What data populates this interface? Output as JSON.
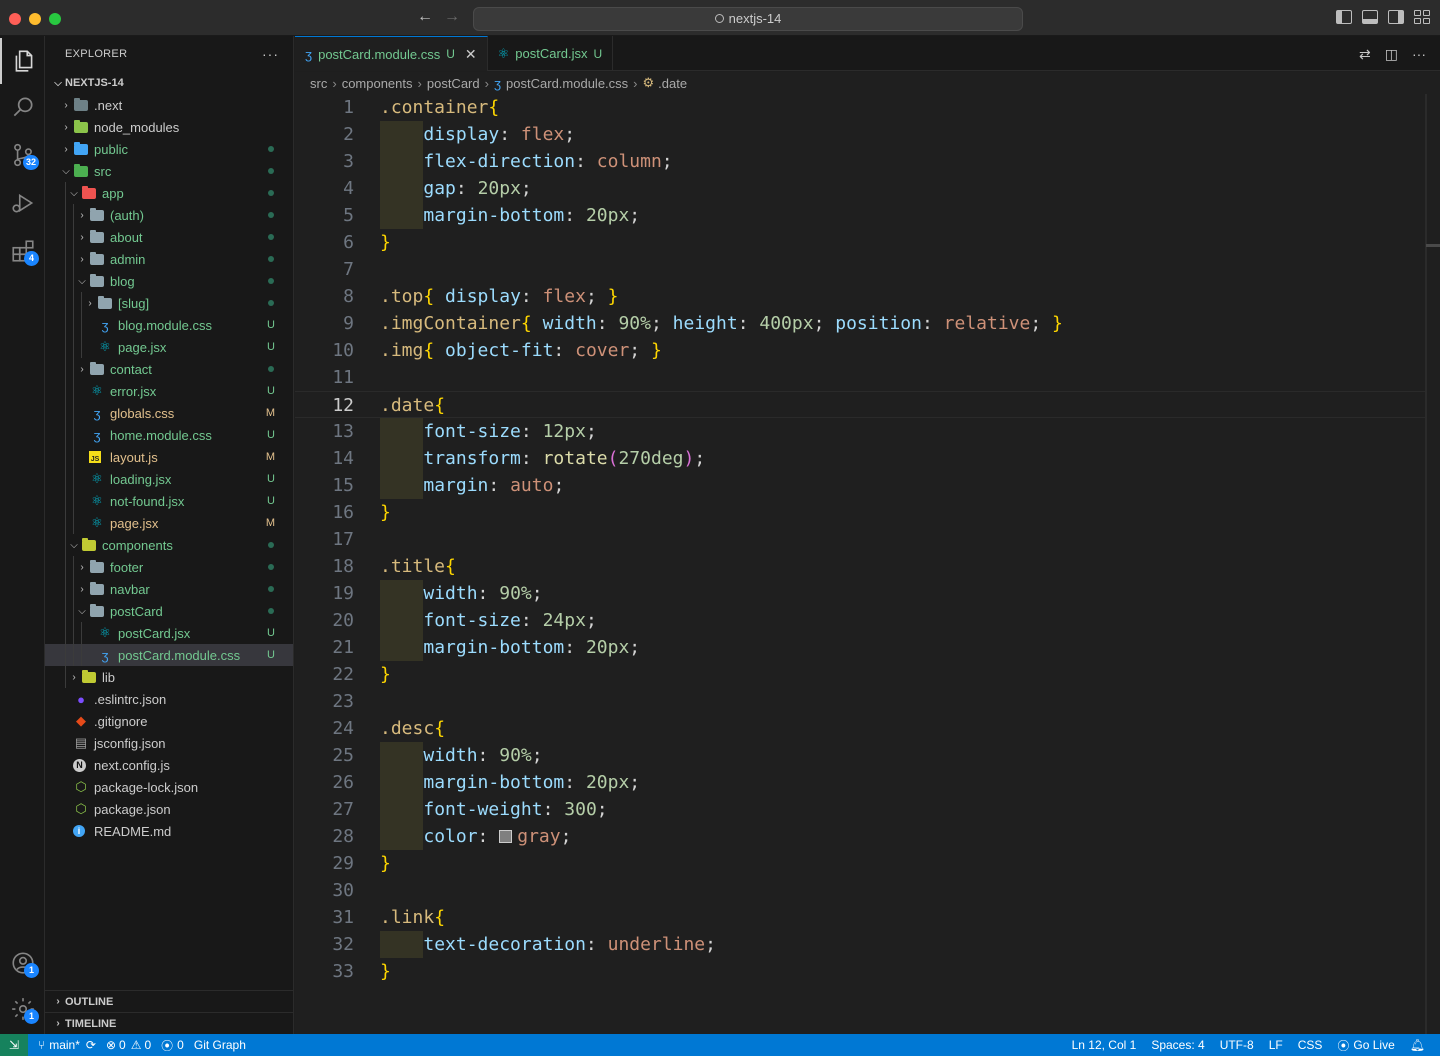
{
  "titlebar": {
    "search_text": "nextjs-14"
  },
  "activity": {
    "source_control_badge": "32",
    "extensions_badge": "4",
    "accounts_badge": "1",
    "manage_badge": "1"
  },
  "sidebar": {
    "title": "EXPLORER",
    "more": "···",
    "root": "NEXTJS-14",
    "tree": [
      {
        "name": ".next",
        "depth": 0,
        "type": "folder",
        "open": false,
        "color": "#6d8086",
        "status": "",
        "dot": false
      },
      {
        "name": "node_modules",
        "depth": 0,
        "type": "folder",
        "open": false,
        "color": "#8bc34a",
        "status": "",
        "dot": false
      },
      {
        "name": "public",
        "depth": 0,
        "type": "folder",
        "open": false,
        "color": "#42a5f5",
        "status": "",
        "dot": true
      },
      {
        "name": "src",
        "depth": 0,
        "type": "folder",
        "open": true,
        "color": "#4caf50",
        "status": "",
        "dot": true
      },
      {
        "name": "app",
        "depth": 1,
        "type": "folder",
        "open": true,
        "color": "#ef5350",
        "status": "",
        "dot": true
      },
      {
        "name": "(auth)",
        "depth": 2,
        "type": "folder",
        "open": false,
        "color": "#90a4ae",
        "status": "",
        "dot": true
      },
      {
        "name": "about",
        "depth": 2,
        "type": "folder",
        "open": false,
        "color": "#90a4ae",
        "status": "",
        "dot": true
      },
      {
        "name": "admin",
        "depth": 2,
        "type": "folder",
        "open": false,
        "color": "#90a4ae",
        "status": "",
        "dot": true
      },
      {
        "name": "blog",
        "depth": 2,
        "type": "folder",
        "open": true,
        "color": "#90a4ae",
        "status": "",
        "dot": true
      },
      {
        "name": "[slug]",
        "depth": 3,
        "type": "folder",
        "open": false,
        "color": "#90a4ae",
        "status": "",
        "dot": true
      },
      {
        "name": "blog.module.css",
        "depth": 3,
        "type": "css",
        "status": "U",
        "dot": false
      },
      {
        "name": "page.jsx",
        "depth": 3,
        "type": "react",
        "status": "U",
        "dot": false
      },
      {
        "name": "contact",
        "depth": 2,
        "type": "folder",
        "open": false,
        "color": "#90a4ae",
        "status": "",
        "dot": true
      },
      {
        "name": "error.jsx",
        "depth": 2,
        "type": "react",
        "status": "U",
        "dot": false
      },
      {
        "name": "globals.css",
        "depth": 2,
        "type": "css",
        "status": "M",
        "dot": false
      },
      {
        "name": "home.module.css",
        "depth": 2,
        "type": "css",
        "status": "U",
        "dot": false
      },
      {
        "name": "layout.js",
        "depth": 2,
        "type": "js",
        "status": "M",
        "dot": false
      },
      {
        "name": "loading.jsx",
        "depth": 2,
        "type": "react",
        "status": "U",
        "dot": false
      },
      {
        "name": "not-found.jsx",
        "depth": 2,
        "type": "react",
        "status": "U",
        "dot": false
      },
      {
        "name": "page.jsx",
        "depth": 2,
        "type": "react",
        "status": "M",
        "dot": false
      },
      {
        "name": "components",
        "depth": 1,
        "type": "folder",
        "open": true,
        "color": "#c0ca33",
        "status": "",
        "dot": true
      },
      {
        "name": "footer",
        "depth": 2,
        "type": "folder",
        "open": false,
        "color": "#90a4ae",
        "status": "",
        "dot": true
      },
      {
        "name": "navbar",
        "depth": 2,
        "type": "folder",
        "open": false,
        "color": "#90a4ae",
        "status": "",
        "dot": true
      },
      {
        "name": "postCard",
        "depth": 2,
        "type": "folder",
        "open": true,
        "color": "#90a4ae",
        "status": "",
        "dot": true
      },
      {
        "name": "postCard.jsx",
        "depth": 3,
        "type": "react",
        "status": "U",
        "dot": false
      },
      {
        "name": "postCard.module.css",
        "depth": 3,
        "type": "css",
        "status": "U",
        "dot": false,
        "selected": true
      },
      {
        "name": "lib",
        "depth": 1,
        "type": "folder",
        "open": false,
        "color": "#c0ca33",
        "status": "",
        "dot": false
      },
      {
        "name": ".eslintrc.json",
        "depth": 0,
        "type": "eslint",
        "status": "",
        "dot": false
      },
      {
        "name": ".gitignore",
        "depth": 0,
        "type": "git",
        "status": "",
        "dot": false
      },
      {
        "name": "jsconfig.json",
        "depth": 0,
        "type": "jsconfig",
        "status": "",
        "dot": false
      },
      {
        "name": "next.config.js",
        "depth": 0,
        "type": "next",
        "status": "",
        "dot": false
      },
      {
        "name": "package-lock.json",
        "depth": 0,
        "type": "npm",
        "status": "",
        "dot": false
      },
      {
        "name": "package.json",
        "depth": 0,
        "type": "npm",
        "status": "",
        "dot": false
      },
      {
        "name": "README.md",
        "depth": 0,
        "type": "info",
        "status": "",
        "dot": false
      }
    ],
    "outline": "OUTLINE",
    "timeline": "TIMELINE"
  },
  "tabs": [
    {
      "label": "postCard.module.css",
      "status": "U",
      "active": true,
      "type": "css"
    },
    {
      "label": "postCard.jsx",
      "status": "U",
      "active": false,
      "type": "react"
    }
  ],
  "breadcrumb": [
    "src",
    "components",
    "postCard",
    "postCard.module.css",
    ".date"
  ],
  "editor": {
    "current_line": 12,
    "lines": [
      ".container{",
      "    display: flex;",
      "    flex-direction: column;",
      "    gap: 20px;",
      "    margin-bottom: 20px;",
      "}",
      "",
      ".top{ display: flex; }",
      ".imgContainer{ width: 90%; height: 400px; position: relative; }",
      ".img{ object-fit: cover; }",
      "",
      ".date{",
      "    font-size: 12px;",
      "    transform: rotate(270deg);",
      "    margin: auto;",
      "}",
      "",
      ".title{",
      "    width: 90%;",
      "    font-size: 24px;",
      "    margin-bottom: 20px;",
      "}",
      "",
      ".desc{",
      "    width: 90%;",
      "    margin-bottom: 20px;",
      "    font-weight: 300;",
      "    color: gray;",
      "}",
      "",
      ".link{",
      "    text-decoration: underline;",
      "}"
    ]
  },
  "statusbar": {
    "branch": "main*",
    "errors": "0",
    "warnings": "0",
    "ports": "0",
    "git_graph": "Git Graph",
    "position": "Ln 12, Col 1",
    "spaces": "Spaces: 4",
    "encoding": "UTF-8",
    "eol": "LF",
    "language": "CSS",
    "go_live": "Go Live"
  },
  "colors": {
    "status_bar": "#0078d4",
    "remote": "#16825d",
    "modified": "#e2c08d",
    "untracked": "#73c991",
    "css_icon": "#42a5f5",
    "react_icon": "#00bcd4"
  }
}
